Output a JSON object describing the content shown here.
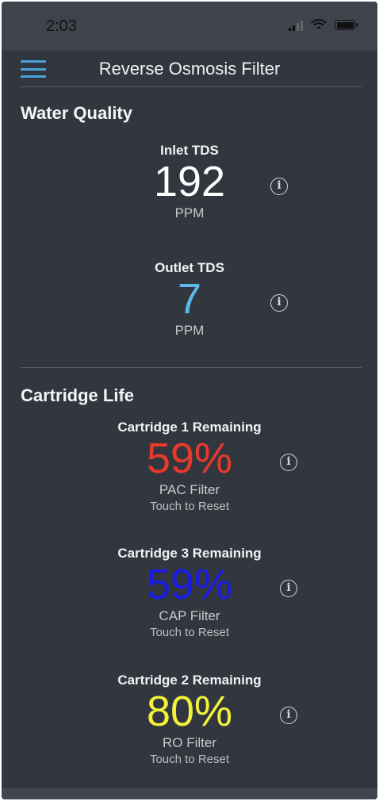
{
  "status_bar": {
    "time": "2:03"
  },
  "header": {
    "title": "Reverse Osmosis Filter"
  },
  "water_quality": {
    "title": "Water Quality",
    "inlet": {
      "label": "Inlet TDS",
      "value": "192",
      "unit": "PPM",
      "color": "#ffffff"
    },
    "outlet": {
      "label": "Outlet TDS",
      "value": "7",
      "unit": "PPM",
      "color": "#5bb8e8"
    }
  },
  "cartridge_life": {
    "title": "Cartridge Life",
    "items": [
      {
        "label": "Cartridge 1 Remaining",
        "value": "59%",
        "filter": "PAC Filter",
        "action": "Touch to Reset",
        "color": "#e8392b"
      },
      {
        "label": "Cartridge 3 Remaining",
        "value": "59%",
        "filter": "CAP Filter",
        "action": "Touch to Reset",
        "color": "#1a1ae6"
      },
      {
        "label": "Cartridge 2 Remaining",
        "value": "80%",
        "filter": "RO Filter",
        "action": "Touch to Reset",
        "color": "#f2f23a"
      }
    ]
  },
  "icons": {
    "menu": "hamburger-menu-icon",
    "info": "info-icon"
  }
}
